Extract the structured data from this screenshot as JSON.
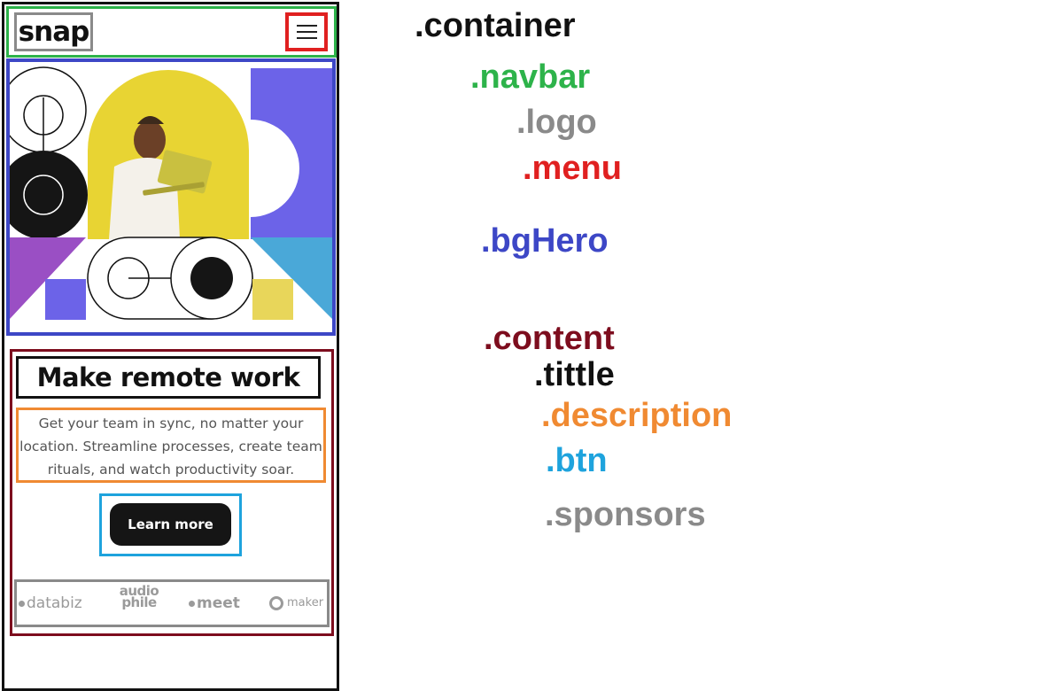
{
  "mockup": {
    "logo_text": "snap",
    "hero_title": "Make remote work",
    "description": "Get your team in sync, no matter your location. Streamline processes, create team rituals, and watch productivity soar.",
    "button_label": "Learn more",
    "sponsors": [
      "databiz",
      "audio phile",
      "meet",
      "maker"
    ]
  },
  "labels": {
    "container": ".container",
    "navbar": ".navbar",
    "logo": ".logo",
    "menu": ".menu",
    "bgHero": ".bgHero",
    "content": ".content",
    "tittle": ".tittle",
    "description": ".description",
    "btn": ".btn",
    "sponsors": ".sponsors"
  },
  "colors": {
    "container": "#111111",
    "navbar": "#2db34a",
    "logo": "#8a8a8a",
    "menu": "#e02020",
    "bgHero": "#3d47c6",
    "content": "#7d0d1e",
    "tittle": "#111111",
    "description": "#f08a32",
    "btn": "#1ea3dd",
    "sponsors": "#8a8a8a"
  }
}
